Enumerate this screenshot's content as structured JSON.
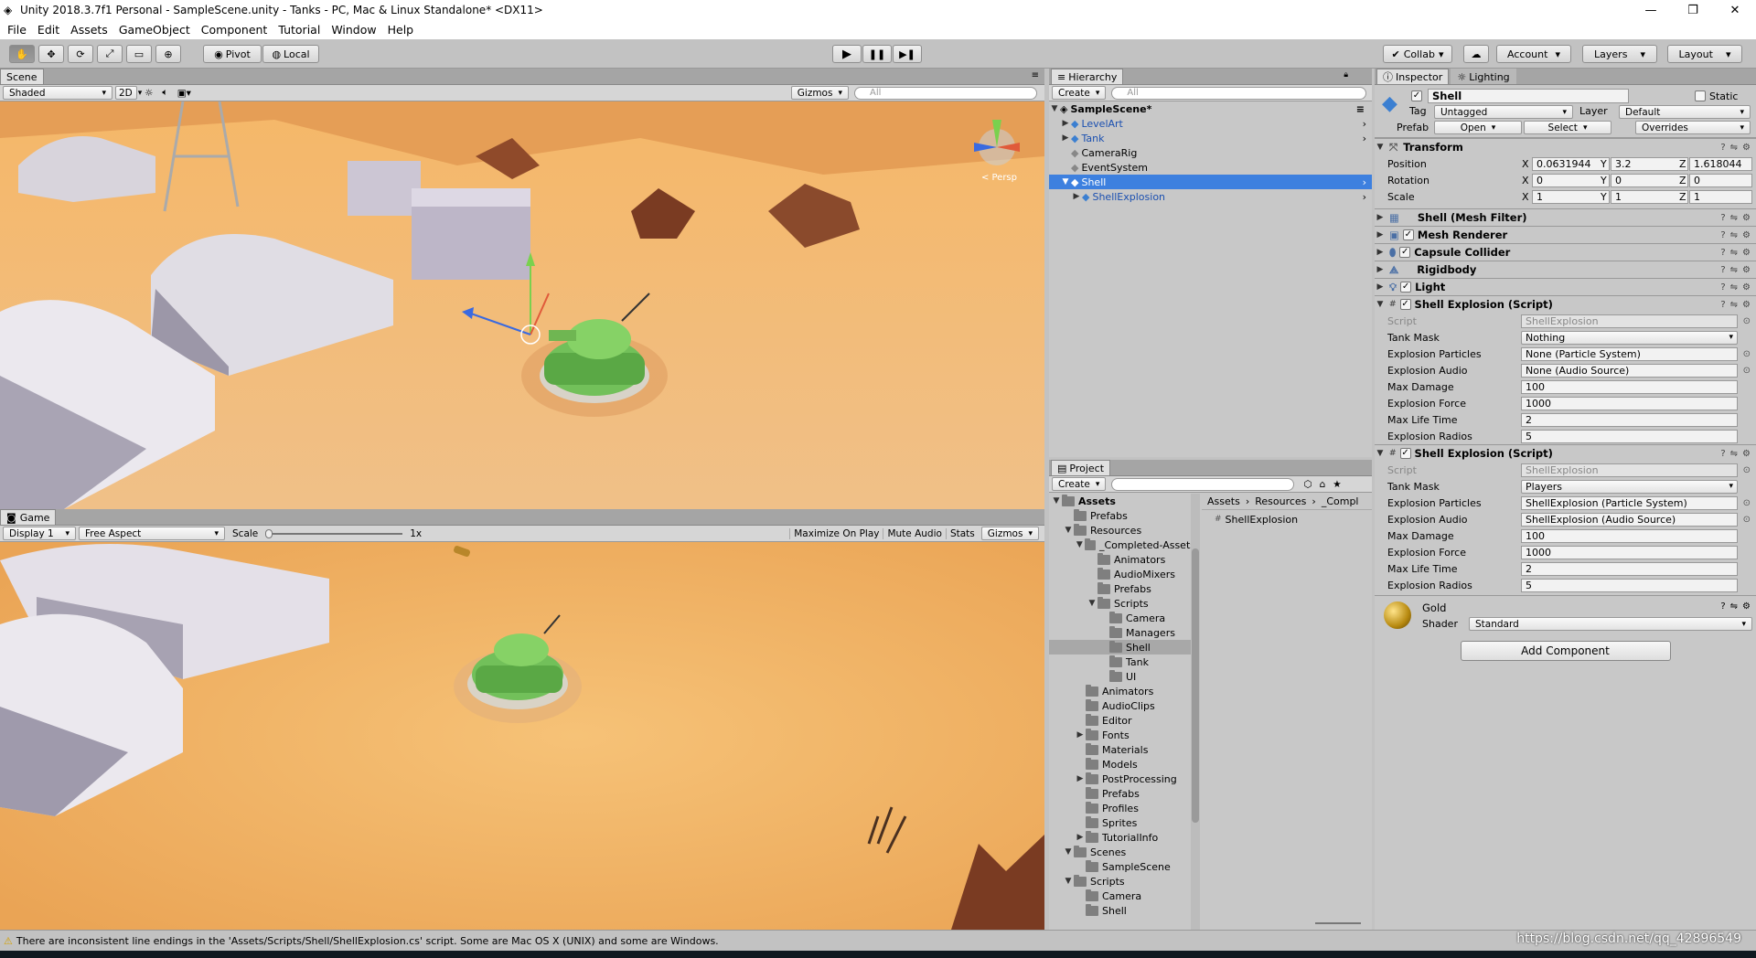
{
  "window": {
    "title": "Unity 2018.3.7f1 Personal - SampleScene.unity - Tanks - PC, Mac & Linux Standalone* <DX11>",
    "min": "—",
    "max": "❐",
    "close": "✕"
  },
  "menu": [
    "File",
    "Edit",
    "Assets",
    "GameObject",
    "Component",
    "Tutorial",
    "Window",
    "Help"
  ],
  "toolbar": {
    "pivot": "Pivot",
    "local": "Local",
    "collab": "Collab",
    "account": "Account",
    "layers": "Layers",
    "layout": "Layout"
  },
  "scene": {
    "tab": "Scene",
    "shading": "Shaded",
    "mode2d": "2D",
    "gizmos": "Gizmos",
    "search": "All",
    "persp": "< Persp"
  },
  "game": {
    "tab": "Game",
    "display": "Display 1",
    "aspect": "Free Aspect",
    "scale_label": "Scale",
    "scale_value": "1x",
    "maximize": "Maximize On Play",
    "mute": "Mute Audio",
    "stats": "Stats",
    "gizmos": "Gizmos"
  },
  "hierarchy": {
    "tab": "Hierarchy",
    "create": "Create",
    "search": "All",
    "scene": "SampleScene*",
    "items": [
      {
        "label": "LevelArt",
        "indent": 1,
        "arrow": "▶",
        "blue": true
      },
      {
        "label": "Tank",
        "indent": 1,
        "arrow": "▶",
        "blue": true
      },
      {
        "label": "CameraRig",
        "indent": 1,
        "arrow": "",
        "blue": false
      },
      {
        "label": "EventSystem",
        "indent": 1,
        "arrow": "",
        "blue": false
      },
      {
        "label": "Shell",
        "indent": 1,
        "arrow": "▼",
        "blue": true,
        "selected": true
      },
      {
        "label": "ShellExplosion",
        "indent": 2,
        "arrow": "▶",
        "blue": true
      }
    ]
  },
  "project": {
    "tab": "Project",
    "create": "Create",
    "breadcrumb": [
      "Assets",
      "Resources",
      "_Compl"
    ],
    "file": "ShellExplosion",
    "tree": [
      {
        "label": "Assets",
        "indent": 0,
        "arrow": "▼",
        "bold": true
      },
      {
        "label": "Prefabs",
        "indent": 1,
        "arrow": ""
      },
      {
        "label": "Resources",
        "indent": 1,
        "arrow": "▼"
      },
      {
        "label": "_Completed-Assets",
        "indent": 2,
        "arrow": "▼"
      },
      {
        "label": "Animators",
        "indent": 3,
        "arrow": ""
      },
      {
        "label": "AudioMixers",
        "indent": 3,
        "arrow": ""
      },
      {
        "label": "Prefabs",
        "indent": 3,
        "arrow": ""
      },
      {
        "label": "Scripts",
        "indent": 3,
        "arrow": "▼"
      },
      {
        "label": "Camera",
        "indent": 4,
        "arrow": ""
      },
      {
        "label": "Managers",
        "indent": 4,
        "arrow": ""
      },
      {
        "label": "Shell",
        "indent": 4,
        "arrow": "",
        "selected": true
      },
      {
        "label": "Tank",
        "indent": 4,
        "arrow": ""
      },
      {
        "label": "UI",
        "indent": 4,
        "arrow": ""
      },
      {
        "label": "Animators",
        "indent": 2,
        "arrow": ""
      },
      {
        "label": "AudioClips",
        "indent": 2,
        "arrow": ""
      },
      {
        "label": "Editor",
        "indent": 2,
        "arrow": ""
      },
      {
        "label": "Fonts",
        "indent": 2,
        "arrow": "▶"
      },
      {
        "label": "Materials",
        "indent": 2,
        "arrow": ""
      },
      {
        "label": "Models",
        "indent": 2,
        "arrow": ""
      },
      {
        "label": "PostProcessing",
        "indent": 2,
        "arrow": "▶"
      },
      {
        "label": "Prefabs",
        "indent": 2,
        "arrow": ""
      },
      {
        "label": "Profiles",
        "indent": 2,
        "arrow": ""
      },
      {
        "label": "Sprites",
        "indent": 2,
        "arrow": ""
      },
      {
        "label": "TutorialInfo",
        "indent": 2,
        "arrow": "▶"
      },
      {
        "label": "Scenes",
        "indent": 1,
        "arrow": "▼"
      },
      {
        "label": "SampleScene",
        "indent": 2,
        "arrow": ""
      },
      {
        "label": "Scripts",
        "indent": 1,
        "arrow": "▼"
      },
      {
        "label": "Camera",
        "indent": 2,
        "arrow": ""
      },
      {
        "label": "Shell",
        "indent": 2,
        "arrow": ""
      }
    ]
  },
  "inspector": {
    "tab": "Inspector",
    "tab2": "Lighting",
    "name": "Shell",
    "static": "Static",
    "tag_label": "Tag",
    "tag": "Untagged",
    "layer_label": "Layer",
    "layer": "Default",
    "prefab_label": "Prefab",
    "open": "Open",
    "select": "Select",
    "overrides": "Overrides",
    "transform": {
      "title": "Transform",
      "position": "Position",
      "rotation": "Rotation",
      "scale": "Scale",
      "pos": [
        "0.0631944",
        "3.2",
        "1.618044"
      ],
      "rot": [
        "0",
        "0",
        "0"
      ],
      "scl": [
        "1",
        "1",
        "1"
      ]
    },
    "components": [
      {
        "title": "Shell (Mesh Filter)",
        "check": false
      },
      {
        "title": "Mesh Renderer",
        "check": true
      },
      {
        "title": "Capsule Collider",
        "check": true
      },
      {
        "title": "Rigidbody",
        "check": false
      },
      {
        "title": "Light",
        "check": true
      }
    ],
    "scripts": [
      {
        "title": "Shell Explosion (Script)",
        "rows": [
          [
            "Script",
            "ShellExplosion"
          ],
          [
            "Tank Mask",
            "Nothing"
          ],
          [
            "Explosion Particles",
            "None (Particle System)"
          ],
          [
            "Explosion Audio",
            "None (Audio Source)"
          ],
          [
            "Max Damage",
            "100"
          ],
          [
            "Explosion Force",
            "1000"
          ],
          [
            "Max Life Time",
            "2"
          ],
          [
            "Explosion Radios",
            "5"
          ]
        ]
      },
      {
        "title": "Shell Explosion (Script)",
        "rows": [
          [
            "Script",
            "ShellExplosion"
          ],
          [
            "Tank Mask",
            "Players"
          ],
          [
            "Explosion Particles",
            "ShellExplosion (Particle System)"
          ],
          [
            "Explosion Audio",
            "ShellExplosion (Audio Source)"
          ],
          [
            "Max Damage",
            "100"
          ],
          [
            "Explosion Force",
            "1000"
          ],
          [
            "Max Life Time",
            "2"
          ],
          [
            "Explosion Radios",
            "5"
          ]
        ]
      }
    ],
    "material": {
      "name": "Gold",
      "shader_label": "Shader",
      "shader": "Standard"
    },
    "add_component": "Add Component"
  },
  "status": {
    "message": "There are inconsistent line endings in the 'Assets/Scripts/Shell/ShellExplosion.cs' script. Some are Mac OS X (UNIX) and some are Windows.",
    "watermark": "https://blog.csdn.net/qq_42896549"
  }
}
